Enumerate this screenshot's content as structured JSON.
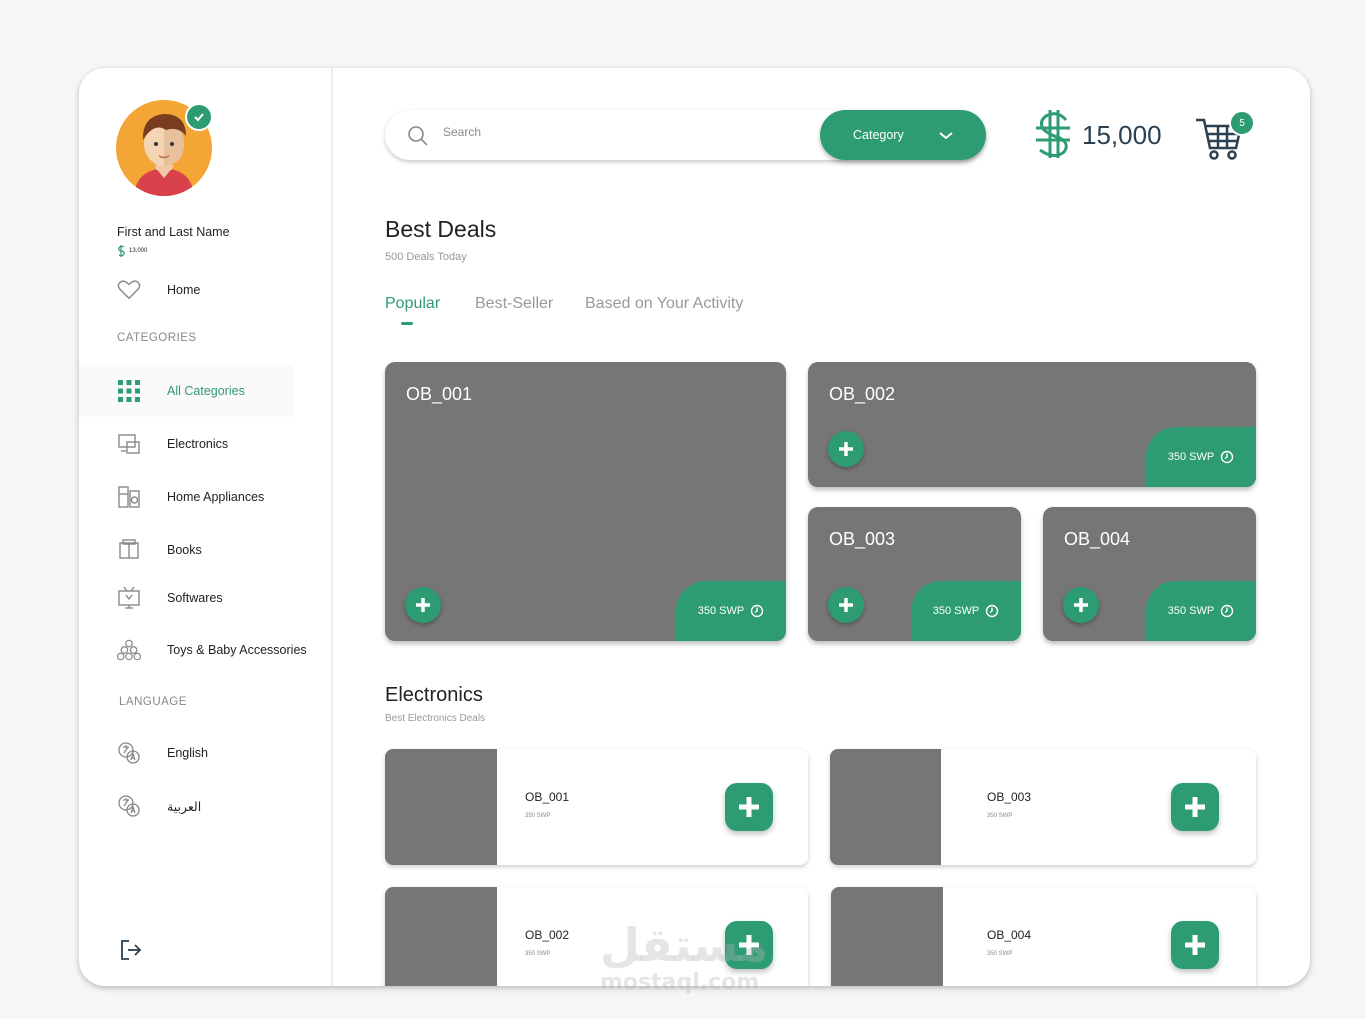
{
  "colors": {
    "accent": "#2d9c72",
    "card": "#767676",
    "text": "#222222",
    "muted": "#999999"
  },
  "user": {
    "name": "First and Last Name",
    "balance": "13,000"
  },
  "nav": {
    "home": "Home",
    "categories_title": "CATEGORIES",
    "categories": [
      {
        "label": "All Categories",
        "icon": "grid-icon",
        "active": true
      },
      {
        "label": "Electronics",
        "icon": "electronics-icon"
      },
      {
        "label": "Home Appliances",
        "icon": "appliances-icon"
      },
      {
        "label": "Books",
        "icon": "books-icon"
      },
      {
        "label": "Softwares",
        "icon": "software-icon"
      },
      {
        "label": "Toys & Baby Accessories",
        "icon": "toys-icon"
      }
    ],
    "language_title": "LANGUAGE",
    "languages": [
      {
        "label": "English",
        "icon": "translate-icon"
      },
      {
        "label": "العربية",
        "icon": "translate-icon"
      }
    ]
  },
  "search": {
    "placeholder": "Search",
    "category_label": "Category"
  },
  "header": {
    "balance": "15,000",
    "cart_count": "5"
  },
  "deals": {
    "title": "Best Deals",
    "subtitle": "500 Deals Today",
    "tabs": [
      "Popular",
      "Best-Seller",
      "Based on Your Activity"
    ],
    "active_tab": "Popular",
    "cards": [
      {
        "title": "OB_001",
        "price": "350 SWP"
      },
      {
        "title": "OB_002",
        "price": "350 SWP"
      },
      {
        "title": "OB_003",
        "price": "350 SWP"
      },
      {
        "title": "OB_004",
        "price": "350 SWP"
      }
    ]
  },
  "electronics": {
    "title": "Electronics",
    "subtitle": "Best Electronics Deals",
    "items": [
      {
        "name": "OB_001",
        "price": "350 SWP"
      },
      {
        "name": "OB_003",
        "price": "350 SWP"
      },
      {
        "name": "OB_002",
        "price": "350 SWP"
      },
      {
        "name": "OB_004",
        "price": "350 SWP"
      }
    ]
  },
  "watermark": {
    "arabic": "مستقل",
    "latin": "mostaql.com"
  }
}
